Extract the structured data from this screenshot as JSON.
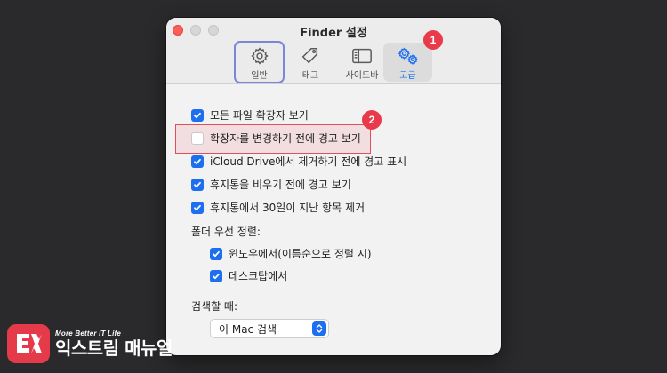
{
  "window": {
    "title": "Finder 설정"
  },
  "tabs": [
    {
      "id": "general",
      "label": "일반",
      "icon": "gear-icon"
    },
    {
      "id": "tags",
      "label": "태그",
      "icon": "tag-icon"
    },
    {
      "id": "sidebar",
      "label": "사이드바",
      "icon": "sidebar-icon"
    },
    {
      "id": "advanced",
      "label": "고급",
      "icon": "gears-icon",
      "selected": true
    }
  ],
  "options": [
    {
      "label": "모든 파일 확장자 보기",
      "checked": true
    },
    {
      "label": "확장자를 변경하기 전에 경고 보기",
      "checked": false
    },
    {
      "label": "iCloud Drive에서 제거하기 전에 경고 표시",
      "checked": true
    },
    {
      "label": "휴지통을 비우기 전에 경고 보기",
      "checked": true
    },
    {
      "label": "휴지통에서 30일이 지난 항목 제거",
      "checked": true
    }
  ],
  "folders_first": {
    "heading": "폴더 우선 정렬:",
    "options": [
      {
        "label": "윈도우에서(이름순으로 정렬 시)",
        "checked": true
      },
      {
        "label": "데스크탑에서",
        "checked": true
      }
    ]
  },
  "search": {
    "heading": "검색할 때:",
    "selected": "이 Mac 검색"
  },
  "annotations": {
    "badge1": "1",
    "badge2": "2"
  },
  "logo": {
    "tagline": "More Better IT Life",
    "name": "익스트림 매뉴얼"
  },
  "colors": {
    "accent": "#1e6ff0",
    "highlight_border": "#e0505a",
    "badge": "#e83a4a",
    "selected_outline": "#7d86d6"
  }
}
